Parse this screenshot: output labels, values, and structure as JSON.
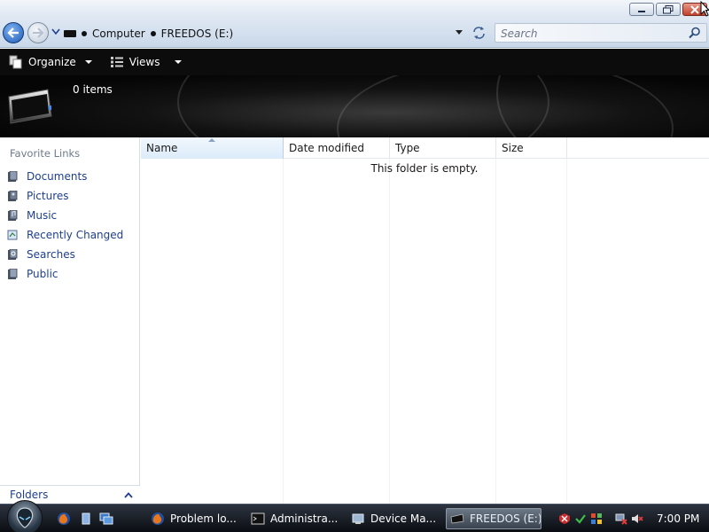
{
  "window": {
    "minimize_icon": "minimize-icon",
    "maximize_icon": "restore-icon",
    "close_icon": "close-icon"
  },
  "address": {
    "path": [
      "Computer",
      "FREEDOS (E:)"
    ],
    "search_placeholder": "Search"
  },
  "toolbar": {
    "organize_label": "Organize",
    "views_label": "Views"
  },
  "details": {
    "item_count": "0 items"
  },
  "navpane": {
    "title": "Favorite Links",
    "items": [
      {
        "label": "Documents",
        "icon": "documents-icon"
      },
      {
        "label": "Pictures",
        "icon": "pictures-icon"
      },
      {
        "label": "Music",
        "icon": "music-icon"
      },
      {
        "label": "Recently Changed",
        "icon": "recently-changed-icon"
      },
      {
        "label": "Searches",
        "icon": "searches-icon"
      },
      {
        "label": "Public",
        "icon": "public-icon"
      }
    ],
    "folders_label": "Folders"
  },
  "filelist": {
    "columns": [
      "Name",
      "Date modified",
      "Type",
      "Size"
    ],
    "empty_message": "This folder is empty."
  },
  "taskbar": {
    "tasks": [
      {
        "label": "Problem lo...",
        "icon": "firefox-icon"
      },
      {
        "label": "Administra...",
        "icon": "command-prompt-icon"
      },
      {
        "label": "Device Ma...",
        "icon": "device-manager-icon"
      },
      {
        "label": "FREEDOS (E:)",
        "icon": "drive-icon",
        "active": true
      }
    ],
    "clock": "7:00 PM"
  },
  "colors": {
    "link_blue": "#1e3f8f",
    "command_bar": "#0c0c0c",
    "address_bar": "#c9d8ea"
  }
}
